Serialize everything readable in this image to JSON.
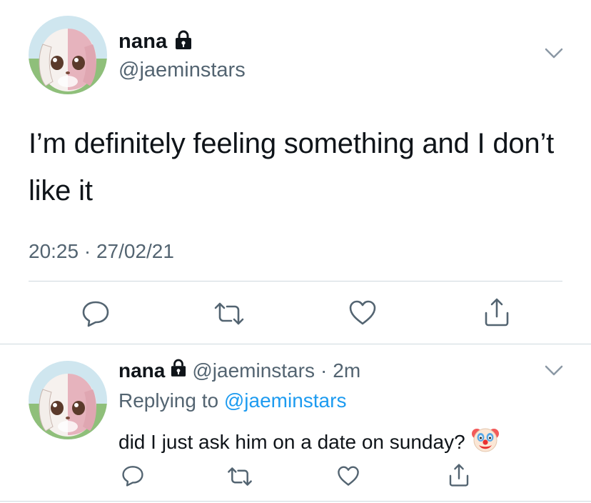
{
  "main_tweet": {
    "author_name": "nana",
    "author_handle": "@jaeminstars",
    "text": "I’m definitely feeling something and I don’t like it",
    "timestamp": "20:25 · 27/02/21",
    "icons": {
      "lock": "lock-icon",
      "more": "chevron-down-icon",
      "reply": "reply-icon",
      "retweet": "retweet-icon",
      "like": "heart-icon",
      "share": "share-icon"
    }
  },
  "reply_tweet": {
    "author_name": "nana",
    "author_handle": "@jaeminstars",
    "separator": "·",
    "age": "2m",
    "replying_prefix": "Replying to",
    "replying_handle": "@jaeminstars",
    "text": "did I just ask him on a date on sunday?",
    "emoji": "clown-face-emoji"
  },
  "colors": {
    "text_primary": "#0f1419",
    "text_secondary": "#536471",
    "link": "#1d9bf0",
    "divider": "#cfd9de",
    "icon": "#536471"
  }
}
